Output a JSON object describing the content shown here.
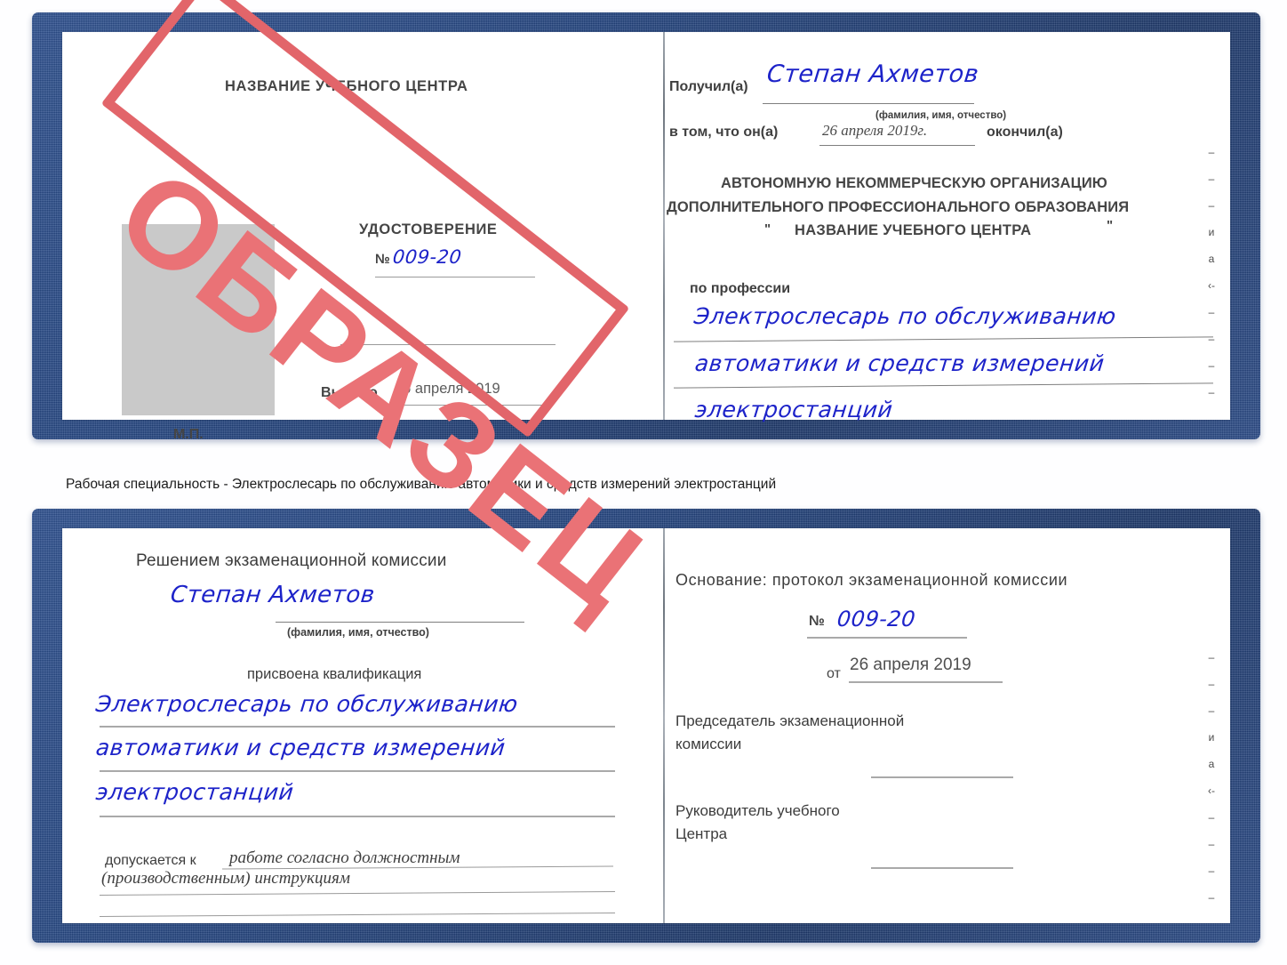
{
  "caption": {
    "text": "Рабочая специальность - Электрослесарь по обслуживанию автоматики и средств измерений электростанций"
  },
  "certificate_top": {
    "left_page": {
      "org_title": "НАЗВАНИЕ УЧЕБНОГО ЦЕНТРА",
      "doc_type": "УДОСТОВЕРЕНИЕ",
      "number_label": "№",
      "number_value": "009-20",
      "issued_label": "Выдано",
      "issued_value": "26 апреля 2019",
      "stamp_place_label": "М.П.",
      "watermark": "ОБРАЗЕЦ"
    },
    "right_page": {
      "received_label": "Получил(а)",
      "received_value": "Степан Ахметов",
      "fio_hint": "(фамилия, имя, отчество)",
      "that_he_label": "в том, что он(а)",
      "completion_date": "26 апреля 2019г.",
      "finished_label": "окончил(а)",
      "org_line1": "АВТОНОМНУЮ НЕКОММЕРЧЕСКУЮ ОРГАНИЗАЦИЮ",
      "org_line2": "ДОПОЛНИТЕЛЬНОГО ПРОФЕССИОНАЛЬНОГО ОБРАЗОВАНИЯ",
      "org_quote_open": "\"",
      "org_line3": "НАЗВАНИЕ УЧЕБНОГО ЦЕНТРА",
      "org_quote_close": "\"",
      "profession_label": "по профессии",
      "profession_line1": "Электрослесарь по обслуживанию",
      "profession_line2": "автоматики и средств измерений",
      "profession_line3": "электростанций",
      "edge_marks": [
        "–",
        "–",
        "–",
        "и",
        "а",
        "‹-",
        "–",
        "–",
        "–",
        "–"
      ]
    }
  },
  "certificate_bottom": {
    "left_page": {
      "decision_title": "Решением экзаменационной комиссии",
      "name_value": "Степан Ахметов",
      "fio_hint": "(фамилия, имя, отчество)",
      "qualification_label": "присвоена квалификация",
      "qualification_line1": "Электрослесарь по обслуживанию",
      "qualification_line2": "автоматики и средств измерений",
      "qualification_line3": "электростанций",
      "admitted_label": "допускается к",
      "admitted_value_line1": "работе согласно должностным",
      "admitted_value_line2": "(производственным) инструкциям"
    },
    "right_page": {
      "basis_label": "Основание: протокол экзаменационной комиссии",
      "number_label": "№",
      "number_value": "009-20",
      "date_label": "от",
      "date_value": "26 апреля 2019",
      "chairman_line1": "Председатель экзаменационной",
      "chairman_line2": "комиссии",
      "head_line1": "Руководитель учебного",
      "head_line2": "Центра",
      "edge_marks": [
        "–",
        "–",
        "–",
        "и",
        "а",
        "‹-",
        "–",
        "–",
        "–",
        "–"
      ]
    }
  },
  "colors": {
    "cover_blue": "#22437e",
    "stamp_red": "#e2656a",
    "handwriting_blue": "#1d23c9",
    "photo_gray": "#c9c9c9",
    "rule_gray": "#9a9a9a"
  }
}
